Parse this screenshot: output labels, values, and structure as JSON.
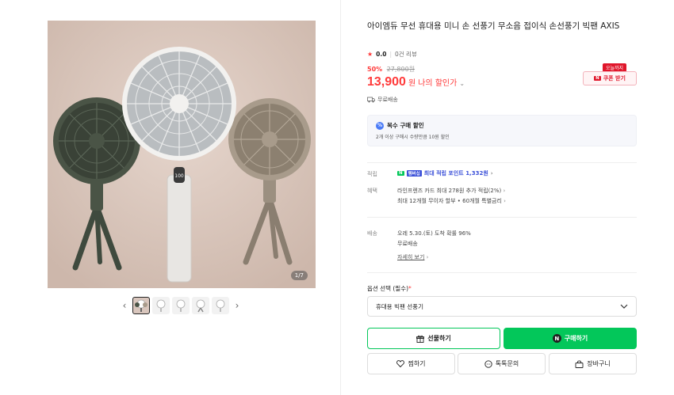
{
  "gallery": {
    "counter": "1/7",
    "thumbnails": [
      {
        "icon": "fan-thumb-icon",
        "active": true
      },
      {
        "icon": "fan-thumb-icon",
        "active": false
      },
      {
        "icon": "fan-thumb-icon",
        "active": false
      },
      {
        "icon": "fan-thumb-icon",
        "active": false
      },
      {
        "icon": "fan-thumb-icon",
        "active": false
      }
    ],
    "prev": "‹",
    "next": "›"
  },
  "product": {
    "title": "아이엠듀 무선 휴대용 미니 손 선풍기 무소음 접이식 손선풍기 빅팬 AXIS",
    "rating": "0.0",
    "reviews": "0건 리뷰",
    "discount_rate": "50%",
    "original_price": "27,800원",
    "price": "13,900",
    "price_unit": "원",
    "my_discount": "나의 할인가",
    "coupon_tag": "오늘까지",
    "coupon_label": "쿠폰 받기",
    "free_shipping": "무료배송"
  },
  "multi_purchase": {
    "title": "복수 구매 할인",
    "desc": "2개 이상 구매시 수량만큼 10원 할인"
  },
  "benefits": {
    "points_label": "적립",
    "points_text": "최대 적립 포인트 1,332원",
    "points_npay": "N",
    "points_membership": "멤버십",
    "benefit_label": "혜택",
    "benefit_line1": "라인프렌즈 카드 최대 278원 추가 적립(2%)",
    "benefit_line2": "최대 12개월 무이자 할부 • 60개월 특별금리"
  },
  "delivery": {
    "label": "배송",
    "line1": "오레 5.30.(토) 도착 확률 96%",
    "line2": "무료배송",
    "details_link": "자세히 보기"
  },
  "option": {
    "label": "옵션 선택 (필수)",
    "required_mark": "*",
    "selected": "휴대용 빅팬 선풍기"
  },
  "actions": {
    "gift": "선물하기",
    "buy": "구매하기",
    "buy_logo": "N",
    "wish": "찜하기",
    "talk": "톡톡문의",
    "cart": "장바구니"
  },
  "colors": {
    "accent_red": "#ff3b3b",
    "naver_green": "#03c75a",
    "image_bg": "#d9c6bd"
  }
}
